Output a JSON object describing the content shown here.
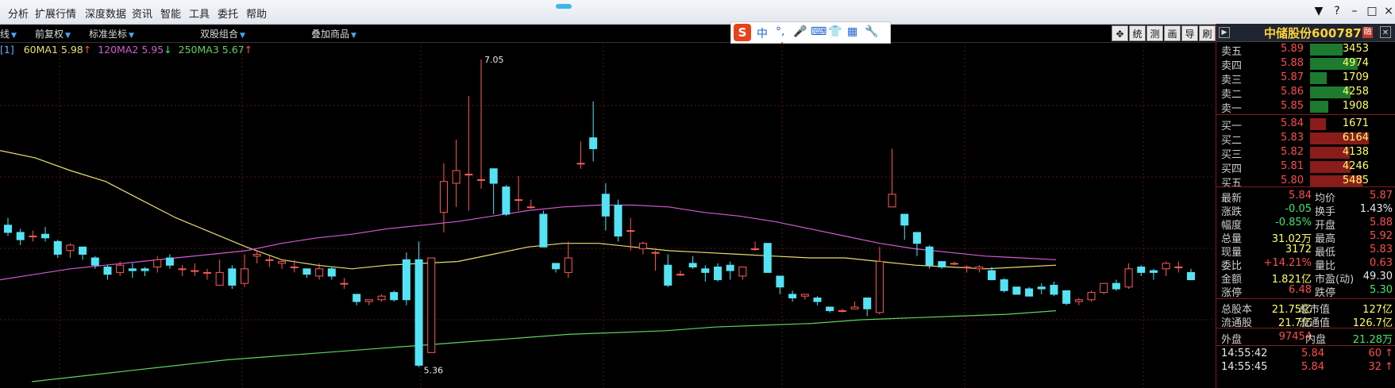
{
  "menu": [
    "分析",
    "扩展行情",
    "深度数据",
    "资讯",
    "智能",
    "工具",
    "委托",
    "帮助"
  ],
  "window_controls": [
    "▼",
    "?",
    "–",
    "□",
    "×"
  ],
  "toolbar": [
    {
      "label": "线",
      "arrow": true
    },
    {
      "label": "前复权",
      "arrow": true
    },
    {
      "label": "标准坐标",
      "arrow": true
    },
    {
      "label": "双股组合",
      "arrow": true
    },
    {
      "label": "叠加商品",
      "arrow": true
    }
  ],
  "ime": {
    "logo": "S",
    "items": [
      "中",
      "°,",
      "🎤",
      "⌨",
      "👕",
      "▦",
      "🔧"
    ]
  },
  "chart_tools": [
    "✥",
    "统",
    "测",
    "画",
    "导",
    "刷"
  ],
  "legend": {
    "tag": "[1]",
    "ma1": {
      "label": "60MA1",
      "value": "5.98",
      "dir": "↑",
      "color": "#e8e070"
    },
    "ma2": {
      "label": "120MA2",
      "value": "5.95",
      "dir": "↓",
      "color": "#d35ad3"
    },
    "ma3": {
      "label": "250MA3",
      "value": "5.67",
      "dir": "↑",
      "color": "#5fd35f"
    }
  },
  "chart_data": {
    "type": "candlestick",
    "y_range": [
      5.28,
      7.12
    ],
    "annotations": {
      "high": "7.05",
      "low": "5.36"
    },
    "candles": [
      [
        6.14,
        6.1,
        6.18,
        6.08
      ],
      [
        6.1,
        6.06,
        6.12,
        6.03
      ],
      [
        6.08,
        6.08,
        6.11,
        6.05
      ],
      [
        6.09,
        6.07,
        6.13,
        6.05
      ],
      [
        6.05,
        5.98,
        6.06,
        5.96
      ],
      [
        6.0,
        6.03,
        6.04,
        5.96
      ],
      [
        6.02,
        5.98,
        6.02,
        5.95
      ],
      [
        5.96,
        5.92,
        5.97,
        5.9
      ],
      [
        5.91,
        5.87,
        5.92,
        5.84
      ],
      [
        5.88,
        5.92,
        5.94,
        5.86
      ],
      [
        5.9,
        5.89,
        5.93,
        5.85
      ],
      [
        5.9,
        5.89,
        5.91,
        5.86
      ],
      [
        5.91,
        5.95,
        5.97,
        5.88
      ],
      [
        5.96,
        5.92,
        5.98,
        5.9
      ],
      [
        5.9,
        5.9,
        5.92,
        5.86
      ],
      [
        5.89,
        5.89,
        5.93,
        5.86
      ],
      [
        5.88,
        5.88,
        5.9,
        5.84
      ],
      [
        5.81,
        5.88,
        5.95,
        5.81
      ],
      [
        5.9,
        5.81,
        5.92,
        5.79
      ],
      [
        5.82,
        5.9,
        5.98,
        5.8
      ],
      [
        5.97,
        5.98,
        6.0,
        5.93
      ],
      [
        5.95,
        5.95,
        5.97,
        5.91
      ],
      [
        5.93,
        5.94,
        5.95,
        5.9
      ],
      [
        5.91,
        5.91,
        5.95,
        5.88
      ],
      [
        5.9,
        5.87,
        5.9,
        5.85
      ],
      [
        5.86,
        5.9,
        5.93,
        5.84
      ],
      [
        5.9,
        5.86,
        5.91,
        5.84
      ],
      [
        5.82,
        5.82,
        5.85,
        5.79
      ],
      [
        5.76,
        5.72,
        5.76,
        5.7
      ],
      [
        5.72,
        5.73,
        5.73,
        5.7
      ],
      [
        5.73,
        5.75,
        5.76,
        5.72
      ],
      [
        5.77,
        5.73,
        5.78,
        5.72
      ],
      [
        5.95,
        5.73,
        5.99,
        5.7
      ],
      [
        5.95,
        5.37,
        6.05,
        5.36
      ],
      [
        5.44,
        5.96,
        5.95,
        5.44
      ],
      [
        6.21,
        6.38,
        6.48,
        6.1
      ],
      [
        6.37,
        6.44,
        6.61,
        6.24
      ],
      [
        6.42,
        6.42,
        6.85,
        6.22
      ],
      [
        6.39,
        6.39,
        7.05,
        6.34
      ],
      [
        6.45,
        6.37,
        6.45,
        6.2
      ],
      [
        6.35,
        6.2,
        6.36,
        6.19
      ],
      [
        6.28,
        6.28,
        6.41,
        6.22
      ],
      [
        6.24,
        6.24,
        6.28,
        6.23
      ],
      [
        6.2,
        6.02,
        6.22,
        6.02
      ],
      [
        5.93,
        5.9,
        5.93,
        5.88
      ],
      [
        5.88,
        5.96,
        6.05,
        5.85
      ],
      [
        6.48,
        6.48,
        6.6,
        6.45
      ],
      [
        6.62,
        6.56,
        6.82,
        6.49
      ],
      [
        6.31,
        6.19,
        6.37,
        6.11
      ],
      [
        6.25,
        6.08,
        6.28,
        6.05
      ],
      [
        6.11,
        6.11,
        6.18,
        6.0
      ],
      [
        6.01,
        6.04,
        6.05,
        5.98
      ],
      [
        5.99,
        5.99,
        6.0,
        5.89
      ],
      [
        5.92,
        5.81,
        5.98,
        5.8
      ],
      [
        5.87,
        5.87,
        5.89,
        5.86
      ],
      [
        5.93,
        5.91,
        5.97,
        5.9
      ],
      [
        5.9,
        5.88,
        5.92,
        5.83
      ],
      [
        5.91,
        5.84,
        5.93,
        5.83
      ],
      [
        5.92,
        5.89,
        5.94,
        5.84
      ],
      [
        5.86,
        5.91,
        5.91,
        5.84
      ],
      [
        6.01,
        6.01,
        6.05,
        6.0
      ],
      [
        6.04,
        5.88,
        6.04,
        5.88
      ],
      [
        5.86,
        5.8,
        5.86,
        5.76
      ],
      [
        5.76,
        5.74,
        5.78,
        5.72
      ],
      [
        5.75,
        5.76,
        5.76,
        5.73
      ],
      [
        5.74,
        5.72,
        5.75,
        5.7
      ],
      [
        5.69,
        5.67,
        5.69,
        5.66
      ],
      [
        5.67,
        5.67,
        5.68,
        5.66
      ],
      [
        5.68,
        5.69,
        5.72,
        5.68
      ],
      [
        5.74,
        5.68,
        5.74,
        5.64
      ],
      [
        5.66,
        5.94,
        6.02,
        5.65
      ],
      [
        6.24,
        6.31,
        6.56,
        6.24
      ],
      [
        6.2,
        6.14,
        6.2,
        6.06
      ],
      [
        6.1,
        6.04,
        6.08,
        5.97
      ],
      [
        6.02,
        5.92,
        6.03,
        5.9
      ],
      [
        5.94,
        5.91,
        5.94,
        5.9
      ],
      [
        5.93,
        5.93,
        5.94,
        5.92
      ],
      [
        5.91,
        5.91,
        5.92,
        5.88
      ],
      [
        5.9,
        5.91,
        5.92,
        5.88
      ],
      [
        5.89,
        5.84,
        5.91,
        5.84
      ],
      [
        5.84,
        5.78,
        5.85,
        5.77
      ],
      [
        5.8,
        5.76,
        5.8,
        5.76
      ],
      [
        5.79,
        5.75,
        5.8,
        5.78
      ],
      [
        5.8,
        5.79,
        5.82,
        5.76
      ],
      [
        5.81,
        5.76,
        5.83,
        5.75
      ],
      [
        5.78,
        5.71,
        5.78,
        5.7
      ],
      [
        5.72,
        5.73,
        5.74,
        5.7
      ],
      [
        5.73,
        5.77,
        5.78,
        5.72
      ],
      [
        5.77,
        5.82,
        5.8,
        5.76
      ],
      [
        5.82,
        5.79,
        5.84,
        5.78
      ],
      [
        5.8,
        5.9,
        5.93,
        5.79
      ],
      [
        5.91,
        5.88,
        5.92,
        5.86
      ],
      [
        5.89,
        5.88,
        5.9,
        5.84
      ],
      [
        5.9,
        5.93,
        5.94,
        5.86
      ],
      [
        5.91,
        5.91,
        5.94,
        5.88
      ],
      [
        5.88,
        5.84,
        5.9,
        5.84
      ]
    ],
    "ma_lines": [
      {
        "name": "60MA1",
        "color": "#e8e070",
        "points": [
          6.55,
          6.51,
          6.44,
          6.38,
          6.28,
          6.18,
          6.1,
          6.02,
          5.95,
          5.92,
          5.9,
          5.92,
          5.93,
          5.94,
          5.98,
          6.02,
          6.04,
          6.04,
          6.02,
          6.0,
          5.99,
          5.98,
          5.97,
          5.96,
          5.96,
          5.94,
          5.92,
          5.91,
          5.9,
          5.91,
          5.92
        ]
      },
      {
        "name": "120MA2",
        "color": "#d35ad3",
        "points": [
          5.84,
          5.87,
          5.9,
          5.92,
          5.94,
          5.96,
          5.98,
          6.0,
          6.04,
          6.07,
          6.09,
          6.12,
          6.14,
          6.16,
          6.19,
          6.22,
          6.24,
          6.25,
          6.25,
          6.24,
          6.21,
          6.19,
          6.16,
          6.12,
          6.08,
          6.04,
          6.01,
          5.99,
          5.97,
          5.96,
          5.95
        ]
      },
      {
        "name": "250MA3",
        "color": "#5fd35f",
        "points": [
          5.28,
          5.31,
          5.34,
          5.37,
          5.4,
          5.42,
          5.44,
          5.46,
          5.48,
          5.5,
          5.52,
          5.54,
          5.55,
          5.56,
          5.58,
          5.59,
          5.6,
          5.62,
          5.63,
          5.64,
          5.65,
          5.67
        ]
      }
    ]
  },
  "stock": {
    "name": "中储股份",
    "code": "600787",
    "badge": "融"
  },
  "order_book": {
    "asks": [
      {
        "label": "卖五",
        "price": "5.89",
        "vol": "3453",
        "bar": 0.56
      },
      {
        "label": "卖四",
        "price": "5.88",
        "vol": "4974",
        "bar": 0.81
      },
      {
        "label": "卖三",
        "price": "5.87",
        "vol": "1709",
        "bar": 0.28
      },
      {
        "label": "卖二",
        "price": "5.86",
        "vol": "4258",
        "bar": 0.69
      },
      {
        "label": "卖一",
        "price": "5.85",
        "vol": "1908",
        "bar": 0.31
      }
    ],
    "bids": [
      {
        "label": "买一",
        "price": "5.84",
        "vol": "1671",
        "bar": 0.27
      },
      {
        "label": "买二",
        "price": "5.83",
        "vol": "6164",
        "bar": 1.0
      },
      {
        "label": "买三",
        "price": "5.82",
        "vol": "4138",
        "bar": 0.67
      },
      {
        "label": "买四",
        "price": "5.81",
        "vol": "4246",
        "bar": 0.69
      },
      {
        "label": "买五",
        "price": "5.80",
        "vol": "5485",
        "bar": 0.89
      }
    ]
  },
  "stats": [
    {
      "l1": "最新",
      "v1": "5.84",
      "c1": "red",
      "l2": "均价",
      "v2": "5.87",
      "c2": "red"
    },
    {
      "l1": "涨跌",
      "v1": "-0.05",
      "c1": "green",
      "l2": "换手",
      "v2": "1.43%",
      "c2": "white"
    },
    {
      "l1": "幅度",
      "v1": "-0.85%",
      "c1": "green",
      "l2": "开盘",
      "v2": "5.88",
      "c2": "red"
    },
    {
      "l1": "总量",
      "v1": "31.02万",
      "c1": "yellow",
      "l2": "最高",
      "v2": "5.92",
      "c2": "red"
    },
    {
      "l1": "现量",
      "v1": "3172",
      "c1": "yellow",
      "l2": "最低",
      "v2": "5.83",
      "c2": "red"
    },
    {
      "l1": "委比",
      "v1": "+14.21%",
      "c1": "red",
      "l2": "量比",
      "v2": "0.63",
      "c2": "red"
    },
    {
      "l1": "金额",
      "v1": "1.821亿",
      "c1": "yellow",
      "l2": "市盈(动)",
      "v2": "49.30",
      "c2": "white"
    },
    {
      "l1": "涨停",
      "v1": "6.48",
      "c1": "red",
      "l2": "跌停",
      "v2": "5.30",
      "c2": "green"
    }
  ],
  "capital": [
    {
      "l1": "总股本",
      "v1": "21.75亿",
      "l2": "总市值",
      "v2": "127亿"
    },
    {
      "l1": "流通股",
      "v1": "21.7亿",
      "l2": "流通值",
      "v2": "126.7亿"
    }
  ],
  "outer_inner": {
    "l1": "外盘",
    "v1": "97454",
    "l2": "内盘",
    "v2": "21.28万"
  },
  "ticks": [
    {
      "time": "14:55:42",
      "price": "5.84",
      "vol": "60",
      "dir": "↑"
    },
    {
      "time": "14:55:45",
      "price": "5.84",
      "vol": "32",
      "dir": "↑"
    }
  ]
}
